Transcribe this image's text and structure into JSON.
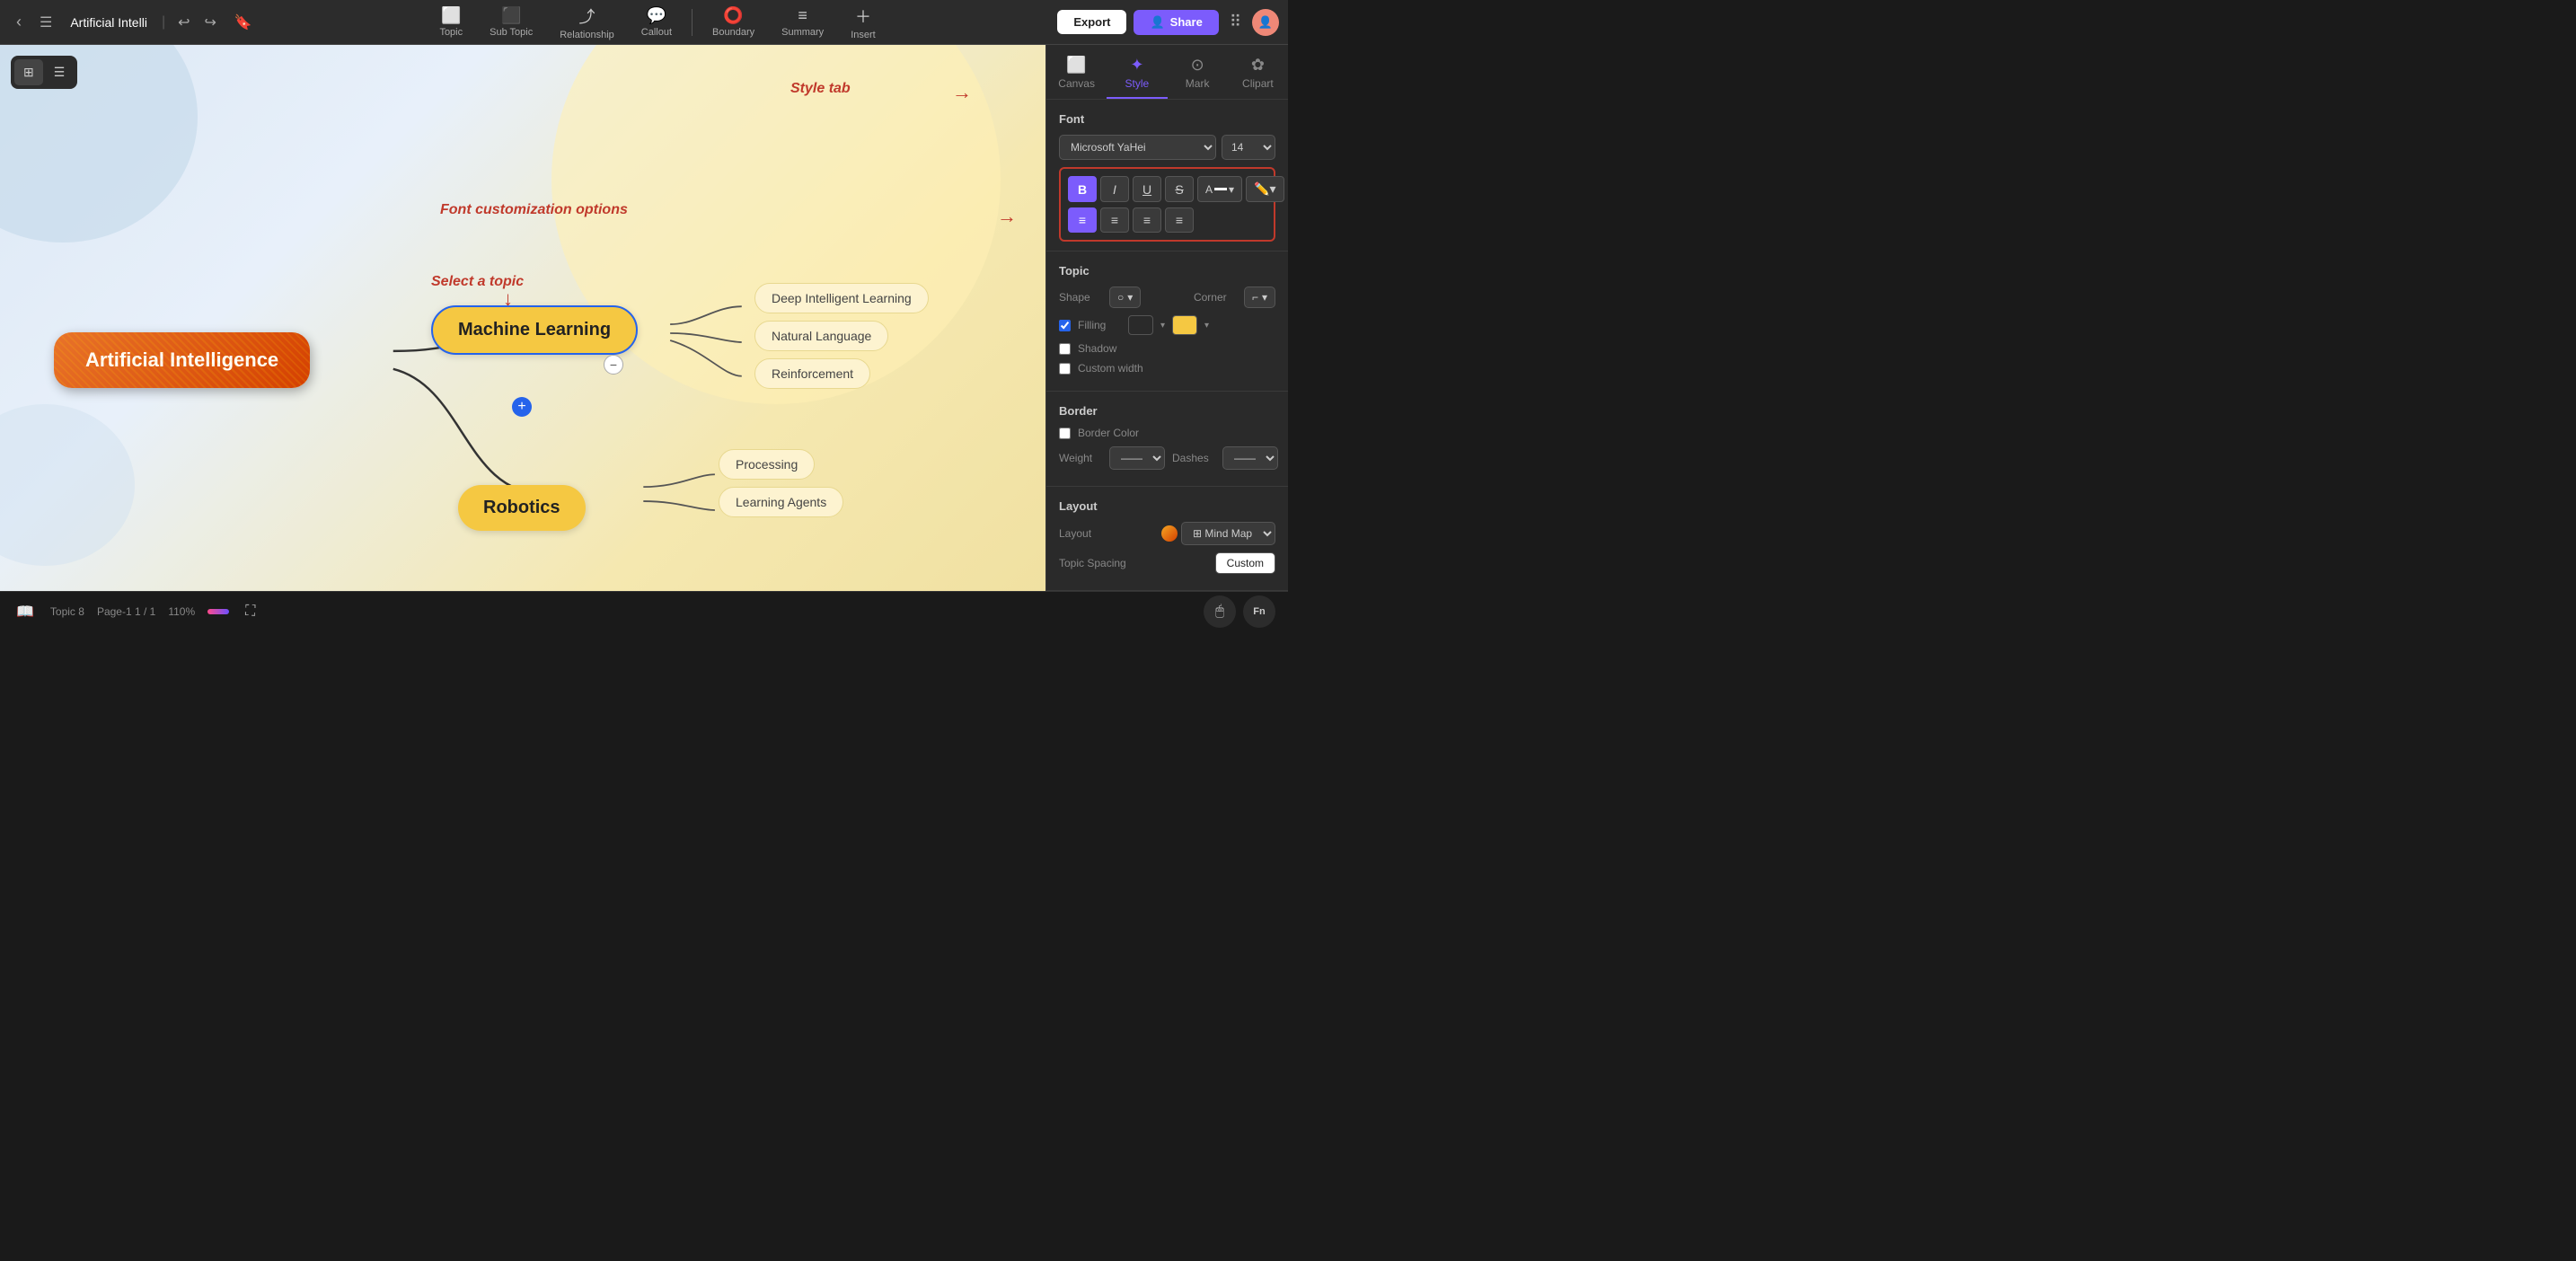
{
  "app": {
    "title": "Artificial Intelli",
    "export_label": "Export",
    "share_label": "Share"
  },
  "toolbar": {
    "tools": [
      {
        "id": "topic",
        "label": "Topic",
        "icon": "⬜"
      },
      {
        "id": "subtopic",
        "label": "Sub Topic",
        "icon": "⬛"
      },
      {
        "id": "relationship",
        "label": "Relationship",
        "icon": "↗"
      },
      {
        "id": "callout",
        "label": "Callout",
        "icon": "💬"
      },
      {
        "id": "boundary",
        "label": "Boundary",
        "icon": "⭕"
      },
      {
        "id": "summary",
        "label": "Summary",
        "icon": "≡"
      },
      {
        "id": "insert",
        "label": "Insert",
        "icon": "+"
      }
    ]
  },
  "right_panel": {
    "tabs": [
      {
        "id": "canvas",
        "label": "Canvas",
        "icon": "⬜"
      },
      {
        "id": "style",
        "label": "Style",
        "icon": "✦",
        "active": true
      },
      {
        "id": "mark",
        "label": "Mark",
        "icon": "⊙"
      },
      {
        "id": "clipart",
        "label": "Clipart",
        "icon": "✿"
      }
    ],
    "font_section": {
      "title": "Font",
      "font_name": "Microsoft YaHei",
      "font_size": "14",
      "bold": true,
      "italic": false,
      "underline": false,
      "strikethrough": false,
      "align_left": true,
      "align_center": false,
      "align_right": false,
      "align_justify": false
    },
    "topic_section": {
      "title": "Topic",
      "shape_label": "Shape",
      "corner_label": "Corner",
      "filling_label": "Filling",
      "shadow_label": "Shadow",
      "custom_width_label": "Custom width"
    },
    "border_section": {
      "title": "Border",
      "border_color_label": "Border Color",
      "weight_label": "Weight",
      "dashes_label": "Dashes"
    },
    "layout_section": {
      "title": "Layout",
      "layout_label": "Layout",
      "topic_spacing_label": "Topic Spacing",
      "custom_label": "Custom"
    }
  },
  "canvas": {
    "annotations": {
      "select_topic": "Select a topic",
      "style_tab": "Style tab",
      "font_custom": "Font customization options"
    },
    "nodes": {
      "root": "Artificial Intelligence",
      "ml": "Machine Learning",
      "robotics": "Robotics",
      "subtopics_ml": [
        "Deep Intelligent Learning",
        "Natural Language",
        "Reinforcement"
      ],
      "subtopics_robotics": [
        "Processing",
        "Learning Agents"
      ]
    }
  },
  "status_bar": {
    "topic_label": "Topic 8",
    "page_label": "Page-1  1 / 1",
    "zoom_label": "110%"
  }
}
